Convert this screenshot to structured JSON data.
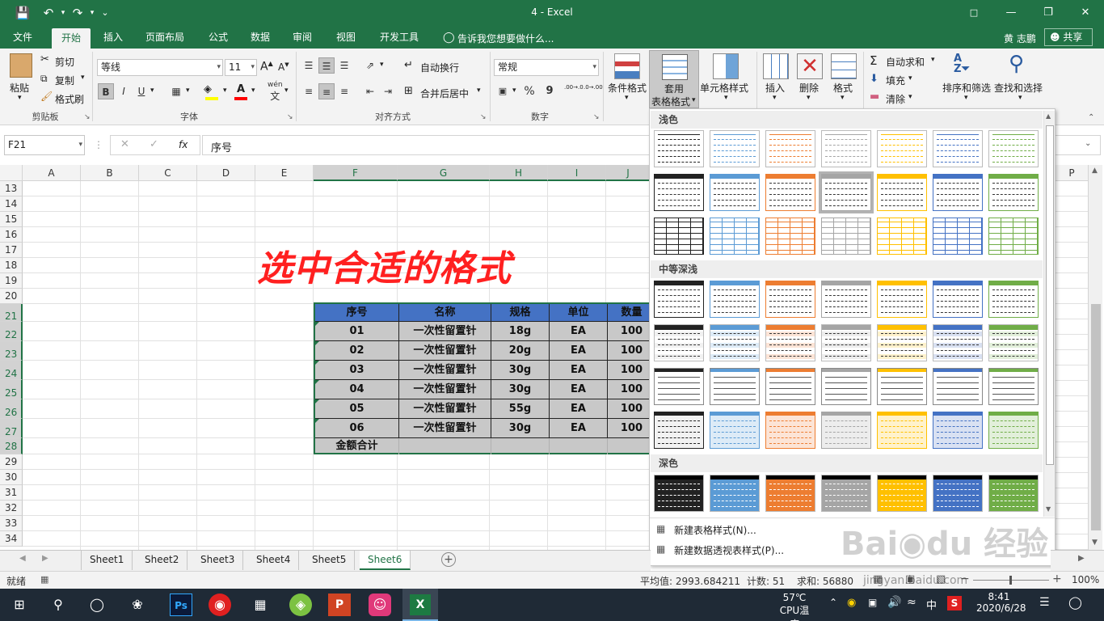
{
  "window": {
    "title": "4 - Excel",
    "user": "黄 志鹏",
    "share": "共享",
    "tell_me": "告诉我您想要做什么..."
  },
  "tabs": [
    "文件",
    "开始",
    "插入",
    "页面布局",
    "公式",
    "数据",
    "审阅",
    "视图",
    "开发工具"
  ],
  "active_tab": "开始",
  "ribbon": {
    "clipboard": {
      "paste": "粘贴",
      "cut": "剪切",
      "copy": "复制",
      "format_painter": "格式刷",
      "label": "剪贴板"
    },
    "font": {
      "name": "等线",
      "size": "11",
      "label": "字体",
      "bold": "B",
      "italic": "I",
      "underline": "U",
      "wen": "wén",
      "wen_char": "文"
    },
    "alignment": {
      "wrap": "自动换行",
      "merge": "合并后居中",
      "label": "对齐方式"
    },
    "number": {
      "format": "常规",
      "label": "数字",
      "percent": "%",
      "comma": "9",
      "inc": ".00→.0",
      "dec": ".0→.00"
    },
    "styles": {
      "conditional": "条件格式",
      "table_line1": "套用",
      "table_line2": "表格格式",
      "cell_style": "单元格样式"
    },
    "cells": {
      "insert": "插入",
      "delete": "删除",
      "format": "格式"
    },
    "editing": {
      "autosum": "自动求和",
      "fill": "填充",
      "clear": "清除",
      "sort": "排序和筛选",
      "find": "查找和选择"
    }
  },
  "formula_bar": {
    "name_box": "F21",
    "fx": "fx",
    "content": "序号"
  },
  "columns": [
    "A",
    "B",
    "C",
    "D",
    "E",
    "F",
    "G",
    "H",
    "I",
    "J"
  ],
  "col_p": "P",
  "rows": [
    "13",
    "14",
    "15",
    "16",
    "17",
    "18",
    "19",
    "20",
    "21",
    "22",
    "23",
    "24",
    "25",
    "26",
    "27",
    "28",
    "29",
    "30",
    "31",
    "32",
    "33",
    "34"
  ],
  "annotation": "选中合适的格式",
  "table": {
    "headers": [
      "序号",
      "名称",
      "规格",
      "单位",
      "数量"
    ],
    "rows": [
      [
        "01",
        "一次性留置针",
        "18g",
        "EA",
        "100"
      ],
      [
        "02",
        "一次性留置针",
        "20g",
        "EA",
        "100"
      ],
      [
        "03",
        "一次性留置针",
        "30g",
        "EA",
        "100"
      ],
      [
        "04",
        "一次性留置针",
        "30g",
        "EA",
        "100"
      ],
      [
        "05",
        "一次性留置针",
        "55g",
        "EA",
        "100"
      ],
      [
        "06",
        "一次性留置针",
        "30g",
        "EA",
        "100"
      ]
    ],
    "total_label": "金额合计"
  },
  "gallery": {
    "sections": [
      "浅色",
      "中等深浅",
      "深色"
    ],
    "accent_colors": [
      "#222222",
      "#5b9bd5",
      "#ed7d31",
      "#a5a5a5",
      "#ffc000",
      "#4472c4",
      "#70ad47"
    ],
    "new_table_style": "新建表格样式(N)...",
    "new_pivot_style": "新建数据透视表样式(P)..."
  },
  "sheets": [
    "Sheet1",
    "Sheet2",
    "Sheet3",
    "Sheet4",
    "Sheet5",
    "Sheet6"
  ],
  "active_sheet": "Sheet6",
  "status": {
    "ready": "就绪",
    "average": "平均值: 2993.684211",
    "count": "计数: 51",
    "sum": "求和: 56880",
    "zoom": "100%"
  },
  "taskbar": {
    "temp": "57℃",
    "temp_label": "CPU温度",
    "time": "8:41",
    "date": "2020/6/28",
    "ime": "中"
  },
  "watermark": "jingyan.baidu.com"
}
